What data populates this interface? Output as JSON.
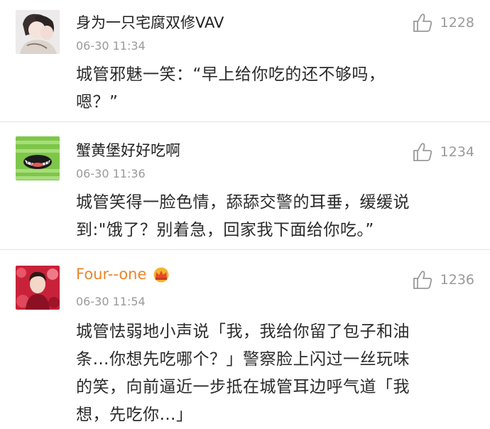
{
  "comments": [
    {
      "username": "身为一只宅腐双修VAV",
      "time": "06-30 11:34",
      "likes": "1228",
      "lines": [
        "城管邪魅一笑：“早上给你吃的还不够吗，",
        "嗯？”"
      ],
      "avatar_icon": "anime-couple-avatar"
    },
    {
      "username": "蟹黄堡好好吃啊",
      "time": "06-30 11:36",
      "likes": "1234",
      "lines": [
        "城管笑得一脸色情，舔舔交警的耳垂，缓缓说",
        "到:\"饿了？别着急，回家我下面给你吃。”"
      ],
      "avatar_icon": "green-smiley-avatar"
    },
    {
      "username": "Four--one",
      "time": "06-30 11:54",
      "likes": "1236",
      "lines": [
        "城管怯弱地小声说「我，我给你留了包子和油",
        "条…你想先吃哪个？」警察脸上闪过一丝玩味",
        "的笑，向前逼近一步抵在城管耳边呼气道「我",
        "想，先吃你…」"
      ],
      "avatar_icon": "red-flowers-avatar",
      "badge_icon": "crown-icon"
    }
  ],
  "colors": {
    "username": "#222222",
    "username_vip": "#e8862a",
    "meta": "#9a9a9a",
    "divider": "#e2e2e2"
  }
}
